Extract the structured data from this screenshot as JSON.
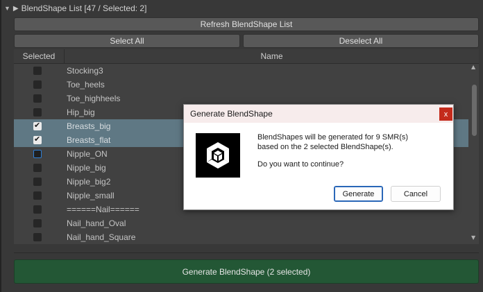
{
  "foldout": {
    "title": "BlendShape List [47 / Selected: 2]"
  },
  "buttons": {
    "refresh": "Refresh BlendShape List",
    "select_all": "Select All",
    "deselect_all": "Deselect All",
    "generate": "Generate BlendShape (2 selected)"
  },
  "table": {
    "col_selected": "Selected",
    "col_name": "Name",
    "rows": [
      {
        "name": "Stocking3",
        "checked": false
      },
      {
        "name": "Toe_heels",
        "checked": false
      },
      {
        "name": "Toe_highheels",
        "checked": false
      },
      {
        "name": "Hip_big",
        "checked": false
      },
      {
        "name": "Breasts_big",
        "checked": true
      },
      {
        "name": "Breasts_flat",
        "checked": true
      },
      {
        "name": "Nipple_ON",
        "checked": false
      },
      {
        "name": "Nipple_big",
        "checked": false
      },
      {
        "name": "Nipple_big2",
        "checked": false
      },
      {
        "name": "Nipple_small",
        "checked": false
      },
      {
        "name": "======Nail======",
        "checked": false
      },
      {
        "name": "Nail_hand_Oval",
        "checked": false
      },
      {
        "name": "Nail_hand_Square",
        "checked": false
      }
    ]
  },
  "dialog": {
    "title": "Generate BlendShape",
    "close": "x",
    "line1": "BlendShapes will be generated for 9 SMR(s)",
    "line2": "based on the 2 selected BlendShape(s).",
    "line3": "Do you want to continue?",
    "ok": "Generate",
    "cancel": "Cancel",
    "logo_icon": "unity-logo-icon"
  },
  "colors": {
    "selection": "#5f7884",
    "generate_button": "#235735",
    "dialog_close": "#c42b1c"
  }
}
